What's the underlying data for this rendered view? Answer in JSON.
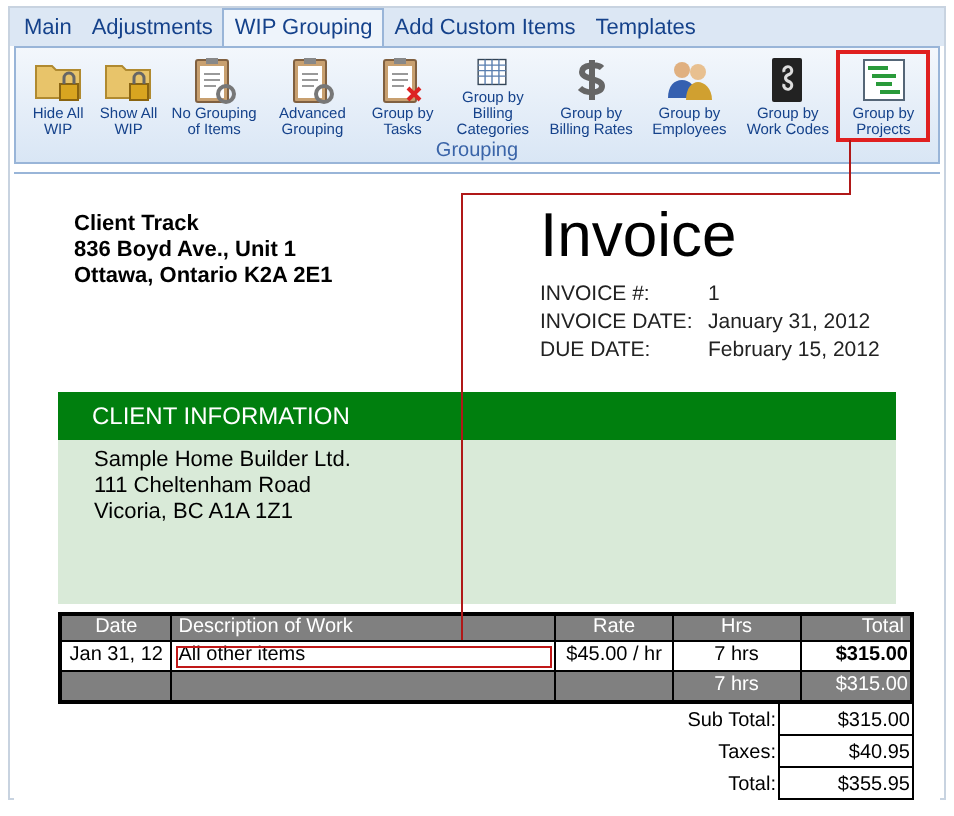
{
  "tabs": [
    {
      "label": "Main",
      "selected": false
    },
    {
      "label": "Adjustments",
      "selected": false
    },
    {
      "label": "WIP Grouping",
      "selected": true
    },
    {
      "label": "Add Custom Items",
      "selected": false
    },
    {
      "label": "Templates",
      "selected": false
    }
  ],
  "ribbon": {
    "group_label": "Grouping",
    "items": [
      {
        "label": "Hide All WIP",
        "kind": "folder",
        "highlighted": false
      },
      {
        "label": "Show All WIP",
        "kind": "folder",
        "highlighted": false
      },
      {
        "label": "No Grouping of Items",
        "kind": "clipboard",
        "highlighted": false
      },
      {
        "label": "Advanced Grouping",
        "kind": "clipboard",
        "highlighted": false
      },
      {
        "label": "Group by Tasks",
        "kind": "clipboard-x",
        "highlighted": false
      },
      {
        "label": "Group by Billing Categories",
        "kind": "grid",
        "highlighted": false
      },
      {
        "label": "Group by Billing Rates",
        "kind": "dollar",
        "highlighted": false
      },
      {
        "label": "Group by Employees",
        "kind": "people",
        "highlighted": false
      },
      {
        "label": "Group by Work Codes",
        "kind": "book",
        "highlighted": false
      },
      {
        "label": "Group by Projects",
        "kind": "chart",
        "highlighted": true
      }
    ]
  },
  "invoice": {
    "company_lines": [
      "Client Track",
      "836 Boyd Ave., Unit 1",
      "Ottawa, Ontario  K2A 2E1"
    ],
    "title": "Invoice",
    "details": [
      {
        "label": "INVOICE #:",
        "value": "1"
      },
      {
        "label": "INVOICE DATE:",
        "value": "January 31, 2012"
      },
      {
        "label": "DUE DATE:",
        "value": "February 15, 2012"
      }
    ],
    "client_header": "CLIENT INFORMATION",
    "client_lines": [
      "Sample Home Builder Ltd.",
      "111 Cheltenham Road",
      "Vicoria, BC  A1A 1Z1"
    ],
    "table": {
      "columns": [
        "Date",
        "Description of Work",
        "Rate",
        "Hrs",
        "Total"
      ],
      "rows": [
        {
          "date": "Jan 31, 12",
          "description": "All other items",
          "rate": "$45.00 / hr",
          "hrs": "7 hrs",
          "total": "$315.00",
          "highlighted": true
        }
      ],
      "footer": {
        "hrs": "7 hrs",
        "total": "$315.00"
      }
    },
    "totals": [
      {
        "label": "Sub Total:",
        "value": "$315.00"
      },
      {
        "label": "Taxes:",
        "value": "$40.95"
      },
      {
        "label": "Total:",
        "value": "$355.95"
      }
    ]
  }
}
